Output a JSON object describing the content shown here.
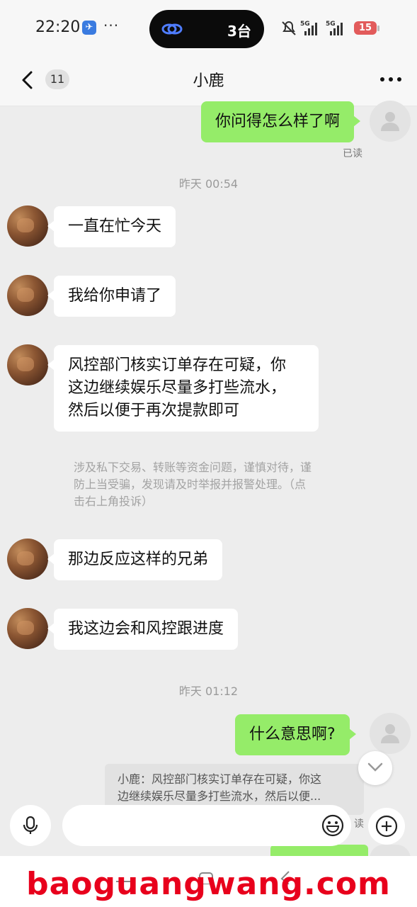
{
  "status_bar": {
    "time": "22:20",
    "overflow": "···",
    "island_text": "3台",
    "battery": "15",
    "signal_label": "5G"
  },
  "nav": {
    "unread_count": "11",
    "title": "小鹿"
  },
  "messages": [
    {
      "side": "right",
      "text": "你问得怎么样了啊"
    },
    {
      "side": "left",
      "text": "一直在忙今天"
    },
    {
      "side": "left",
      "text": "我给你申请了"
    },
    {
      "side": "left",
      "lines": [
        "风控部门核实订单存在可疑，你",
        "这边继续娱乐尽量多打些流水，",
        "然后以便于再次提款即可"
      ]
    },
    {
      "side": "left",
      "text": "那边反应这样的兄弟"
    },
    {
      "side": "left",
      "text": "我这边会和风控跟进度"
    },
    {
      "side": "right",
      "text": "什么意思啊?"
    }
  ],
  "read_status": "已读",
  "read_partial": "读",
  "timestamps": [
    "昨天 00:54",
    "昨天 01:12"
  ],
  "warning": {
    "lines": [
      "涉及私下交易、转账等资金问题，谨慎对待，谨",
      "防上当受骗，发现请及时举报并报警处理。（点",
      "击右上角投诉）"
    ]
  },
  "quote": {
    "lines": [
      "小鹿：风控部门核实订单存在可疑，你这",
      "边继续娱乐尽量多打些流水，然后以便..."
    ]
  },
  "input": {
    "placeholder": ""
  },
  "watermark": "baoguangwang.com",
  "colors": {
    "my_bubble": "#95ec69",
    "their_bubble": "#ffffff",
    "background": "#ededed",
    "watermark": "#e8001c",
    "battery": "#e25b5b"
  },
  "icons": [
    "back-arrow-icon",
    "more-icon",
    "voice-icon",
    "emoji-icon",
    "plus-icon",
    "chevron-down-icon",
    "mute-icon",
    "signal-icon",
    "battery-icon",
    "link-icon"
  ]
}
